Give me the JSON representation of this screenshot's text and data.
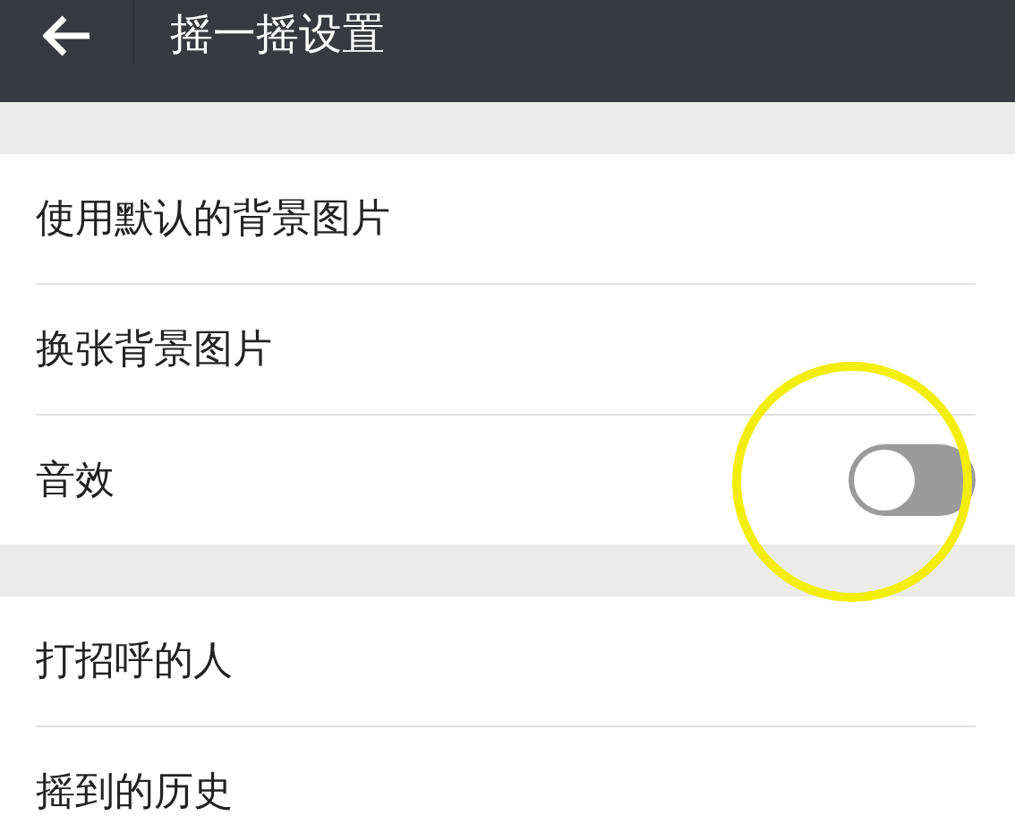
{
  "header": {
    "title": "摇一摇设置"
  },
  "groups": [
    {
      "rows": [
        {
          "kind": "link",
          "label": "使用默认的背景图片"
        },
        {
          "kind": "link",
          "label": "换张背景图片"
        },
        {
          "kind": "toggle",
          "label": "音效",
          "on": false
        }
      ]
    },
    {
      "rows": [
        {
          "kind": "link",
          "label": "打招呼的人"
        },
        {
          "kind": "link",
          "label": "摇到的历史"
        }
      ]
    }
  ]
}
